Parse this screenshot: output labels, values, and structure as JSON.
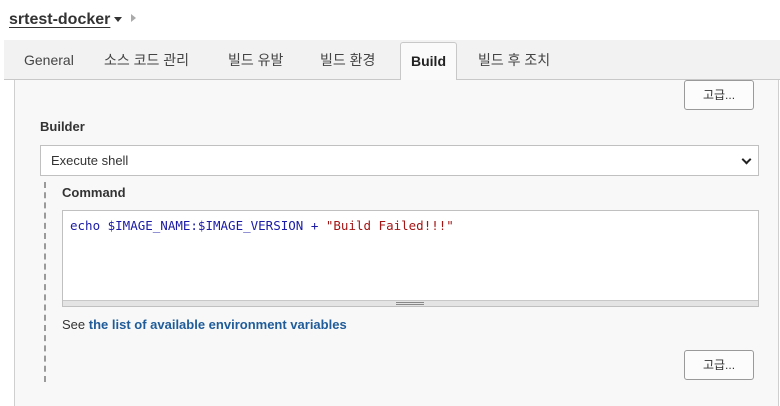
{
  "header": {
    "job_name": "srtest-docker"
  },
  "tabs": [
    {
      "label": "General"
    },
    {
      "label": "소스 코드 관리"
    },
    {
      "label": "빌드 유발"
    },
    {
      "label": "빌드 환경"
    },
    {
      "label": "Build",
      "active": true
    },
    {
      "label": "빌드 후 조치"
    }
  ],
  "build": {
    "advanced_top_label": "고급...",
    "builder_label": "Builder",
    "builder_selected": "Execute shell",
    "command_label": "Command",
    "command_cmd": "echo $IMAGE_NAME:$IMAGE_VERSION + ",
    "command_str": "\"Build Failed!!!\"",
    "see_text": "See ",
    "see_link": "the list of available environment variables",
    "advanced_bottom_label": "고급..."
  },
  "colors": {
    "link": "#1f5c99",
    "code_command": "#1a1aa6",
    "code_string": "#a31515"
  }
}
